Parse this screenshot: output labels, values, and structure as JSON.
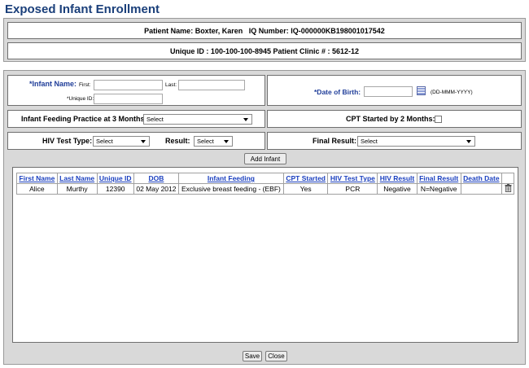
{
  "page": {
    "title": "Exposed Infant Enrollment"
  },
  "patient": {
    "info_line": "Patient Name: Boxter, Karen   IQ Number: IQ-000000KB198001017542",
    "id_line": "Unique ID : 100-100-100-8945 Patient Clinic # : 5612-12"
  },
  "form": {
    "infant_name_label": "*Infant Name:",
    "first_label": "First:",
    "last_label": "Last:",
    "unique_id_label": "*Unique ID:",
    "first_value": "",
    "last_value": "",
    "unique_id_value": "",
    "dob_label": "*Date of Birth:",
    "dob_value": "",
    "dob_format": "(DD-MMM-YYYY)",
    "feeding_label": "Infant Feeding Practice at 3 Months:",
    "feeding_value": "Select",
    "cpt_label": "CPT Started by 2 Months:",
    "cpt_checked": false,
    "hiv_test_type_label": "HIV Test Type:",
    "hiv_test_type_value": "Select",
    "result_label": "Result:",
    "result_value": "Select",
    "final_result_label": "Final Result:",
    "final_result_value": "Select",
    "add_infant_label": "Add Infant"
  },
  "table": {
    "columns": [
      "First Name",
      "Last Name",
      "Unique ID",
      "DOB",
      "Infant Feeding",
      "CPT Started",
      "HIV Test Type",
      "HIV Result",
      "Final Result",
      "Death Date"
    ],
    "rows": [
      [
        "Alice",
        "Murthy",
        "12390",
        "02 May 2012",
        "Exclusive breast feeding - (EBF)",
        "Yes",
        "PCR",
        "Negative",
        "N=Negative",
        ""
      ]
    ]
  },
  "footer": {
    "save_label": "Save",
    "close_label": "Close"
  },
  "colors": {
    "title": "#1a3f7a",
    "label_blue": "#1f3d99",
    "link": "#1a3fbf",
    "panel": "#d9d9d9"
  }
}
